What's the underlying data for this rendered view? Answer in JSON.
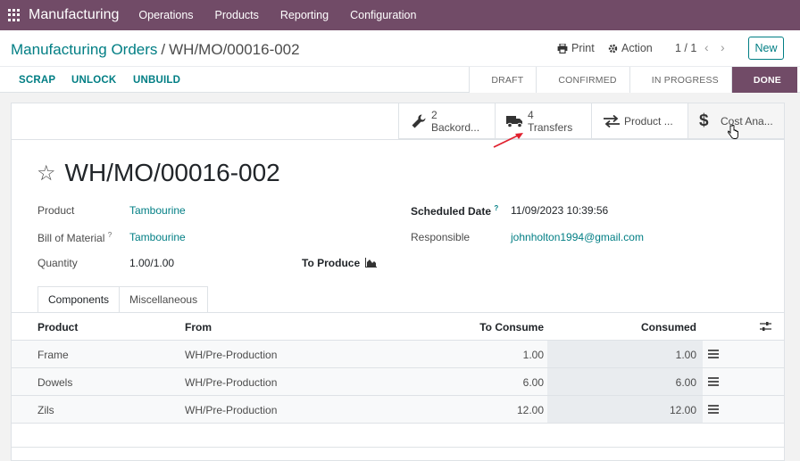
{
  "navbar": {
    "app_name": "Manufacturing",
    "menu": [
      "Operations",
      "Products",
      "Reporting",
      "Configuration"
    ]
  },
  "breadcrumb": {
    "parent": "Manufacturing Orders",
    "separator": "/",
    "current": "WH/MO/00016-002"
  },
  "toolbar": {
    "print_label": "Print",
    "action_label": "Action",
    "pager": "1 / 1",
    "new_label": "New"
  },
  "header_buttons": [
    "SCRAP",
    "UNLOCK",
    "UNBUILD"
  ],
  "statusbar": {
    "stages": [
      "DRAFT",
      "CONFIRMED",
      "IN PROGRESS",
      "DONE"
    ],
    "active": "DONE"
  },
  "smart_buttons": [
    {
      "count": "2",
      "label": "Backord...",
      "icon": "wrench-icon"
    },
    {
      "count": "4",
      "label": "Transfers",
      "icon": "truck-icon"
    },
    {
      "count": "",
      "label": "Product ...",
      "icon": "exchange-icon"
    },
    {
      "count": "",
      "label": "Cost Ana...",
      "icon": "dollar-icon"
    }
  ],
  "record": {
    "title": "WH/MO/00016-002",
    "product_label": "Product",
    "product_value": "Tambourine",
    "bom_label": "Bill of Material",
    "bom_value": "Tambourine",
    "quantity_label": "Quantity",
    "quantity_value": "1.00/1.00",
    "to_produce_label": "To Produce",
    "scheduled_label": "Scheduled Date",
    "scheduled_value": "11/09/2023 10:39:56",
    "responsible_label": "Responsible",
    "responsible_value": "johnholton1994@gmail.com",
    "help_mark": "?"
  },
  "tabs": [
    "Components",
    "Miscellaneous"
  ],
  "table": {
    "headers": [
      "Product",
      "From",
      "To Consume",
      "Consumed"
    ],
    "rows": [
      {
        "product": "Frame",
        "from": "WH/Pre-Production",
        "to_consume": "1.00",
        "consumed": "1.00"
      },
      {
        "product": "Dowels",
        "from": "WH/Pre-Production",
        "to_consume": "6.00",
        "consumed": "6.00"
      },
      {
        "product": "Zils",
        "from": "WH/Pre-Production",
        "to_consume": "12.00",
        "consumed": "12.00"
      }
    ]
  },
  "colors": {
    "brand": "#714b67",
    "link": "#017e84",
    "annotation_arrow": "#e0202e"
  }
}
